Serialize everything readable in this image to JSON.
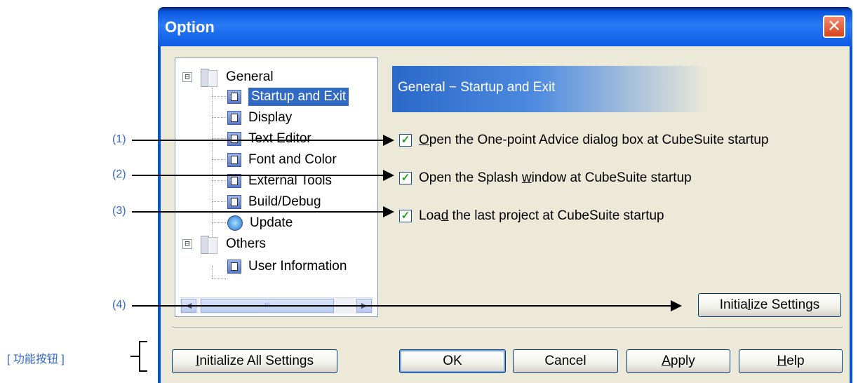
{
  "window": {
    "title": "Option",
    "close_glyph": "✕"
  },
  "tree": {
    "groups": [
      {
        "label": "General",
        "expander": "⊟",
        "items": [
          {
            "label": "Startup and Exit",
            "selected": true,
            "icon": "page-icon"
          },
          {
            "label": "Display",
            "icon": "page-icon"
          },
          {
            "label": "Text Editor",
            "icon": "page-icon"
          },
          {
            "label": "Font and Color",
            "icon": "page-icon"
          },
          {
            "label": "External Tools",
            "icon": "page-icon"
          },
          {
            "label": "Build/Debug",
            "icon": "page-icon"
          },
          {
            "label": "Update",
            "icon": "update-icon"
          }
        ]
      },
      {
        "label": "Others",
        "expander": "⊟",
        "items": [
          {
            "label": "User Information",
            "icon": "page-icon"
          }
        ]
      }
    ],
    "scroll_left": "◀",
    "scroll_right": "▶",
    "scroll_grip": "III"
  },
  "panel": {
    "header": "General − Startup and Exit",
    "options": [
      {
        "pre": "",
        "mnemonic": "O",
        "post": "pen the One-point Advice dialog box at CubeSuite startup",
        "checked": true
      },
      {
        "pre": "Open the Splash ",
        "mnemonic": "w",
        "post": "indow at CubeSuite startup",
        "checked": true
      },
      {
        "pre": "Loa",
        "mnemonic": "d",
        "post": " the last project at CubeSuite startup",
        "checked": true
      }
    ],
    "check_glyph": "✓",
    "initialize_settings": {
      "pre": "Initia",
      "mnemonic": "l",
      "post": "ize Settings"
    }
  },
  "buttons": {
    "initialize_all": {
      "pre": "",
      "mnemonic": "I",
      "post": "nitialize All Settings"
    },
    "ok": "OK",
    "cancel": "Cancel",
    "apply": {
      "pre": "",
      "mnemonic": "A",
      "post": "pply"
    },
    "help": {
      "pre": "",
      "mnemonic": "H",
      "post": "elp"
    }
  },
  "annotations": {
    "labels": [
      "(1)",
      "(2)",
      "(3)",
      "(4)"
    ],
    "function_buttons": "[ 功能按钮 ]"
  },
  "colors": {
    "title_bar": "#0a58e0",
    "selection": "#316ac5",
    "annotation_text": "#3366cc",
    "dialog_bg": "#ece9d8"
  }
}
